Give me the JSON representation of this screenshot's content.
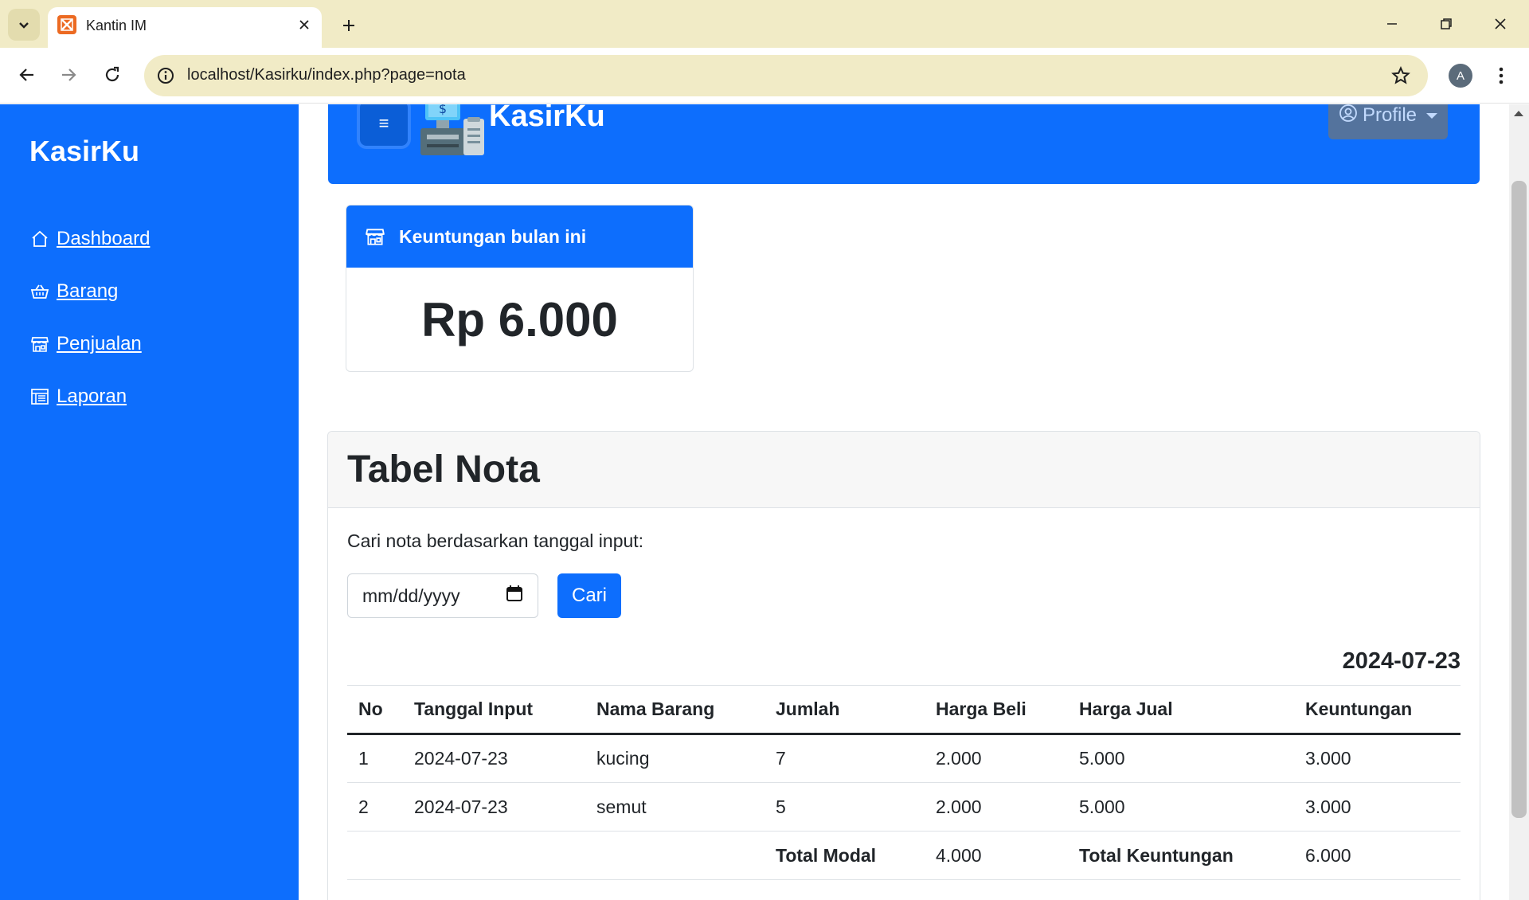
{
  "browser": {
    "tab_title": "Kantin IM",
    "url": "localhost/Kasirku/index.php?page=nota",
    "profile_initial": "A"
  },
  "sidebar": {
    "brand": "KasirKu",
    "items": [
      {
        "label": " Dashboard",
        "icon": "home-icon"
      },
      {
        "label": " Barang",
        "icon": "basket-icon"
      },
      {
        "label": " Penjualan",
        "icon": "shop-icon"
      },
      {
        "label": " Laporan",
        "icon": "report-icon"
      }
    ]
  },
  "topbar": {
    "hamburger": "≡",
    "title": "KasirKu",
    "profile_label": "Profile"
  },
  "profit_card": {
    "title": "Keuntungan bulan ini",
    "value": "Rp 6.000"
  },
  "nota": {
    "title": "Tabel Nota",
    "search_label": "Cari nota berdasarkan tanggal input:",
    "date_placeholder": "mm/dd/yyyy",
    "search_button": "Cari",
    "selected_date": "2024-07-23",
    "columns": [
      "No",
      "Tanggal Input",
      "Nama Barang",
      "Jumlah",
      "Harga Beli",
      "Harga Jual",
      "Keuntungan"
    ],
    "rows": [
      [
        "1",
        "2024-07-23",
        "kucing",
        "7",
        "2.000",
        "5.000",
        "3.000"
      ],
      [
        "2",
        "2024-07-23",
        "semut",
        "5",
        "2.000",
        "5.000",
        "3.000"
      ]
    ],
    "footer": {
      "modal_label": "Total Modal",
      "modal_value": "4.000",
      "profit_label": "Total Keuntungan",
      "profit_value": "6.000"
    }
  },
  "colors": {
    "primary": "#0d6efd",
    "chrome": "#f1ebc6"
  }
}
